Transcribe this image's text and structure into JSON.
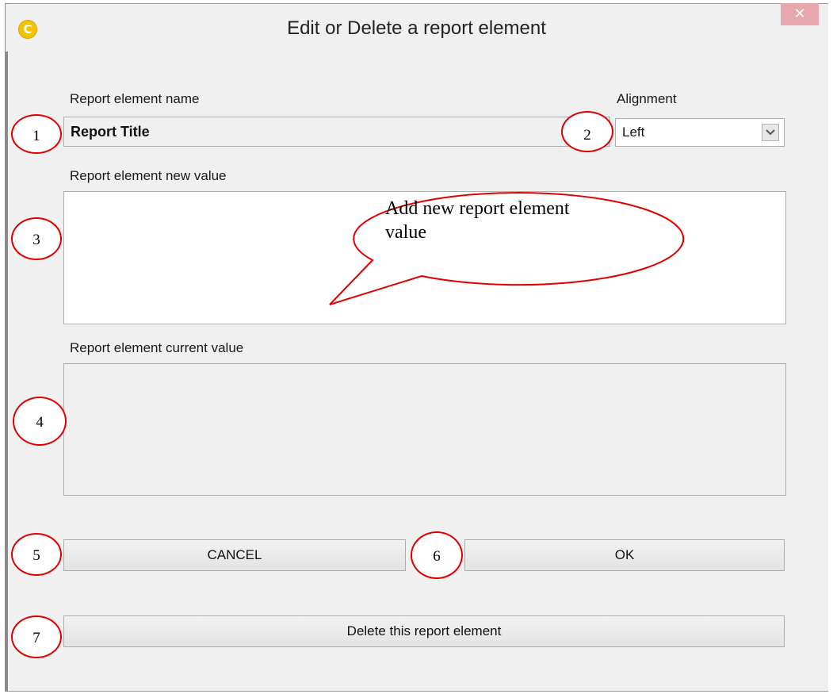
{
  "window": {
    "title": "Edit or Delete a report element",
    "close_glyph": "✕",
    "app_icon_letter": "C"
  },
  "fields": {
    "name_label": "Report element name",
    "name_value": "Report Title",
    "alignment_label": "Alignment",
    "alignment_value": "Left",
    "new_value_label": "Report element new value",
    "new_value_text": "",
    "current_value_label": "Report element current value",
    "current_value_text": ""
  },
  "buttons": {
    "cancel": "CANCEL",
    "ok": "OK",
    "delete": "Delete this report element"
  },
  "annotations": {
    "callout": "Add new report element value",
    "markers": [
      "1",
      "2",
      "3",
      "4",
      "5",
      "6",
      "7"
    ]
  },
  "colors": {
    "marker_outline": "#e00000",
    "window_bg": "#f0f0f0",
    "app_icon": "#f3c200",
    "close_button": "#e8a6ae"
  },
  "icons": {
    "app": "app-logo-icon",
    "close": "close-icon",
    "dropdown": "chevron-down-icon"
  }
}
